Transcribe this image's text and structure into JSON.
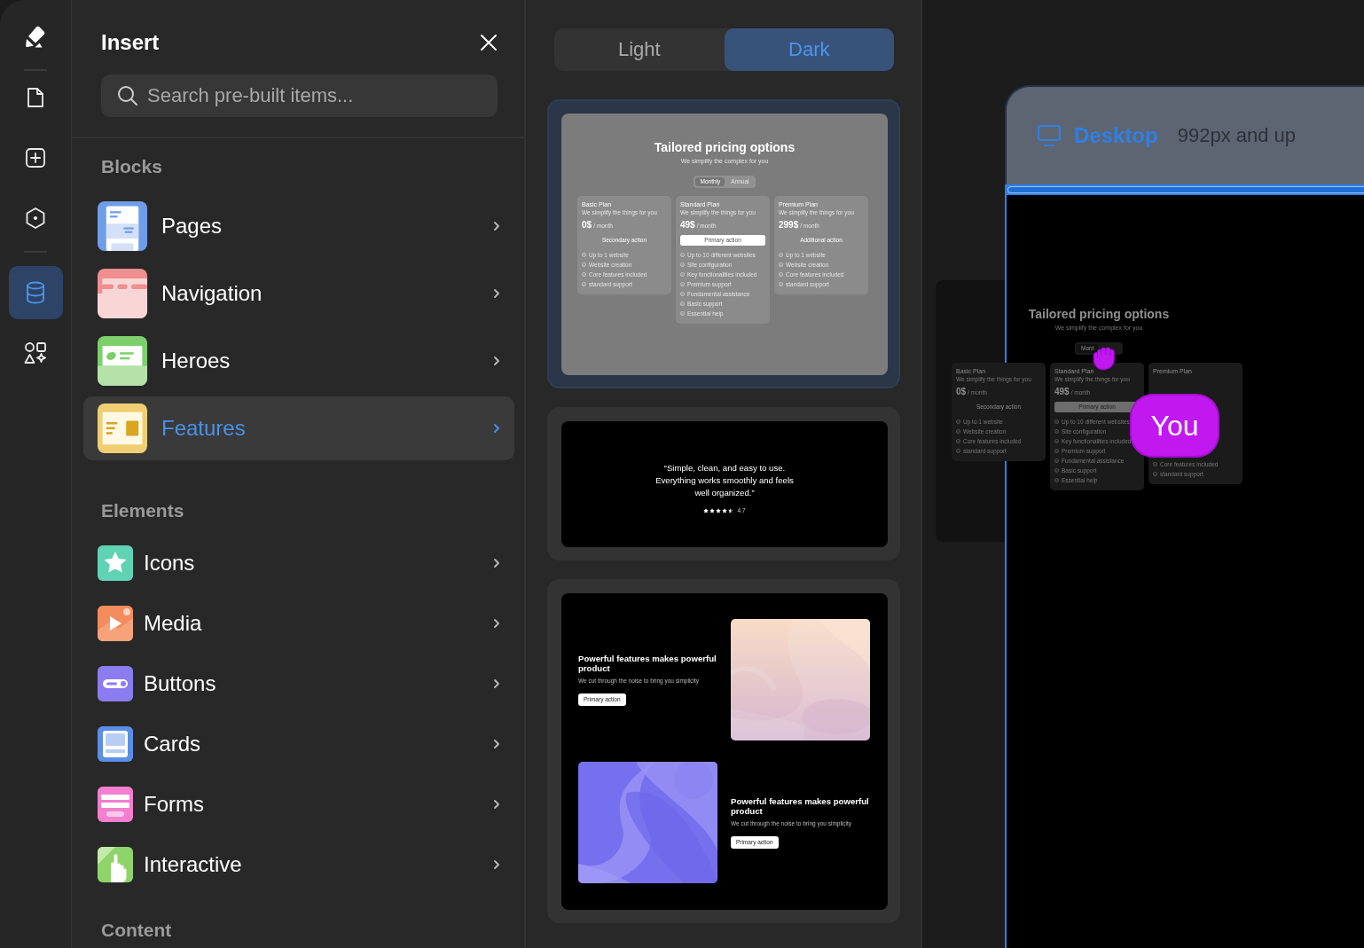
{
  "rail": {
    "items": [
      {
        "kind": "page",
        "selected": false
      },
      {
        "kind": "add",
        "selected": false
      },
      {
        "kind": "component",
        "selected": false
      },
      {
        "kind": "data",
        "selected": true
      },
      {
        "kind": "assets",
        "selected": false
      }
    ]
  },
  "insert_panel": {
    "title": "Insert",
    "search": {
      "placeholder": "Search pre-built items..."
    },
    "sections": [
      {
        "title": "Blocks",
        "kind": "large",
        "items": [
          {
            "label": "Pages",
            "kind": "pages",
            "color": "#6f9ee8",
            "selected": false
          },
          {
            "label": "Navigation",
            "kind": "navigation",
            "color": "#ef8f8f",
            "selected": false
          },
          {
            "label": "Heroes",
            "kind": "heroes",
            "color": "#7ccf6b",
            "selected": false
          },
          {
            "label": "Features",
            "kind": "features",
            "color": "#f0cf74",
            "selected": true
          }
        ]
      },
      {
        "title": "Elements",
        "kind": "small",
        "items": [
          {
            "label": "Icons",
            "kind": "icons",
            "color": "#5fd3b3",
            "selected": false
          },
          {
            "label": "Media",
            "kind": "media",
            "color": "#f28c5c",
            "selected": false
          },
          {
            "label": "Buttons",
            "kind": "buttons",
            "color": "#8b7cf0",
            "selected": false
          },
          {
            "label": "Cards",
            "kind": "cards",
            "color": "#5b8fe6",
            "selected": false
          },
          {
            "label": "Forms",
            "kind": "forms",
            "color": "#f27fcf",
            "selected": false
          },
          {
            "label": "Interactive",
            "kind": "interactive",
            "color": "#8fd46a",
            "selected": false
          }
        ]
      },
      {
        "title": "Content",
        "kind": "small"
      }
    ]
  },
  "gallery": {
    "themes": [
      {
        "label": "Light",
        "selected": false
      },
      {
        "label": "Dark",
        "selected": true
      }
    ],
    "templates": [
      {
        "kind": "pricing",
        "selected": true,
        "title": "Tailored pricing options",
        "subtitle": "We simplify the complex for you",
        "billing": [
          {
            "label": "Monthly",
            "selected": true
          },
          {
            "label": "Annual",
            "selected": false
          }
        ],
        "plans": [
          {
            "name": "Basic Plan",
            "description": "We simplify the things for you",
            "price": "0$",
            "period": "/ month",
            "action": {
              "label": "Secondary action",
              "kind": "secondary"
            },
            "features": [
              "Up to 1 website",
              "Website creation",
              "Core features included",
              "standard support"
            ]
          },
          {
            "name": "Standard Plan",
            "description": "We simplify the things for you",
            "price": "49$",
            "period": "/ month",
            "action": {
              "label": "Primary action",
              "kind": "primary"
            },
            "features": [
              "Up to 10 different websites",
              "Site configuration",
              "Key functionalities included",
              "Premium support",
              "Fundamental assistance",
              "Basic support",
              "Essential help"
            ]
          },
          {
            "name": "Premium Plan",
            "description": "We simplify the things for you",
            "price": "299$",
            "period": "/ month",
            "action": {
              "label": "Additional action",
              "kind": "secondary"
            },
            "features": [
              "Up to 1 website",
              "Website creation",
              "Core features included",
              "standard support"
            ]
          }
        ]
      },
      {
        "kind": "testimonial",
        "selected": false,
        "quote": "“Simple, clean, and easy to use. Everything works smoothly and feels well organized.”",
        "stars": 4.5,
        "rating": "4.7"
      },
      {
        "kind": "features",
        "selected": false,
        "rows": [
          {
            "kind": "image-right",
            "title": "Powerful features makes powerful product",
            "text": "We cut through the noise to bring you simplicity",
            "action": "Primary action"
          },
          {
            "kind": "image-left",
            "title": "Powerful features makes powerful product",
            "text": "We cut through the noise to bring you simplicity",
            "action": "Primary action"
          }
        ]
      }
    ]
  },
  "canvas": {
    "breakpoint": {
      "label": "Desktop",
      "range": "992px and up"
    },
    "section": {
      "title": "Tailored pricing options",
      "subtitle": "We simplify the complex for you",
      "billing": [
        {
          "label": "Mont",
          "selected": true
        }
      ],
      "plans": [
        {
          "name": "Basic Plan",
          "description": "We simplify the things for you",
          "price": "0$",
          "period": "/ month",
          "action": {
            "label": "Secondary action",
            "kind": "secondary"
          },
          "features": [
            "Up to 1 website",
            "Website creation",
            "Core features included",
            "standard support"
          ]
        },
        {
          "name": "Standard Plan",
          "description": "We simplify the things for you",
          "price": "49$",
          "period": "/ month",
          "action": {
            "label": "Primary action",
            "kind": "primary"
          },
          "features": [
            "Up to 10 different websites",
            "Site configuration",
            "Key functionalities included",
            "Premium support",
            "Fundamental assistance",
            "Basic support",
            "Essential help"
          ]
        },
        {
          "name": "Premium Plan",
          "features": [
            "Core features included",
            "standard support"
          ]
        }
      ]
    },
    "cursor": {
      "label": "You"
    }
  }
}
